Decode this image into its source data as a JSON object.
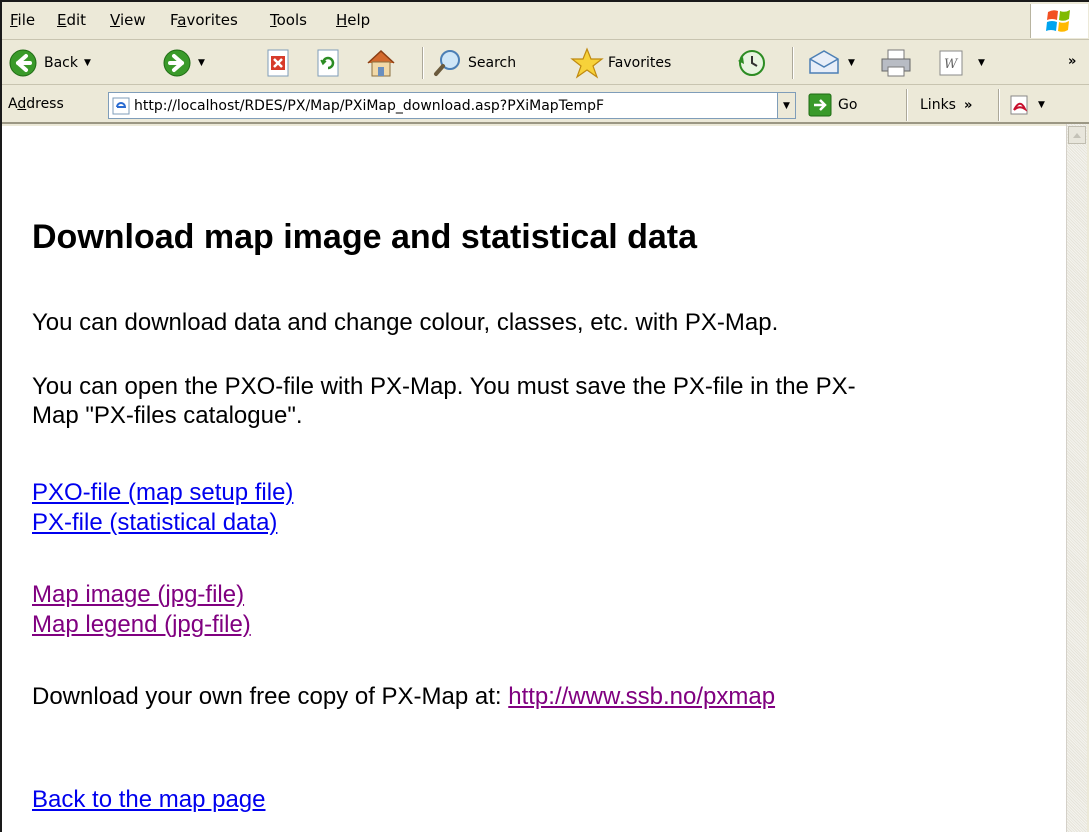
{
  "menubar": {
    "items": [
      {
        "underline": "F",
        "rest": "ile"
      },
      {
        "underline": "E",
        "rest": "dit"
      },
      {
        "underline": "V",
        "rest": "iew"
      },
      {
        "pre": "F",
        "underline": "a",
        "rest": "vorites"
      },
      {
        "underline": "T",
        "rest": "ools"
      },
      {
        "underline": "H",
        "rest": "elp"
      }
    ]
  },
  "toolbar": {
    "back_label": "Back",
    "search_label": "Search",
    "favorites_label": "Favorites"
  },
  "address": {
    "label_pre": "A",
    "label_u": "d",
    "label_post": "dress",
    "url": "http://localhost/RDES/PX/Map/PXiMap_download.asp?PXiMapTempF",
    "go_label": "Go",
    "links_label": "Links"
  },
  "content": {
    "title": "Download map image and statistical data",
    "para1": "You can download data and change colour, classes, etc. with PX-Map.",
    "para2_line1": "You can open the PXO-file with PX-Map. You must save the PX-file in the PX-",
    "para2_line2": "Map \"PX-files catalogue\".",
    "link_pxo": "PXO-file (map setup file)",
    "link_px": "PX-file (statistical data)",
    "link_map_image": "Map image (jpg-file)",
    "link_map_legend": "Map legend (jpg-file)",
    "download_text": "Download your own free copy of PX-Map at: ",
    "download_link": "http://www.ssb.no/pxmap",
    "link_back": "Back to the map page"
  },
  "colors": {
    "link_unvisited": "#0000ee",
    "link_visited": "#800080",
    "chrome": "#ece9d8"
  }
}
